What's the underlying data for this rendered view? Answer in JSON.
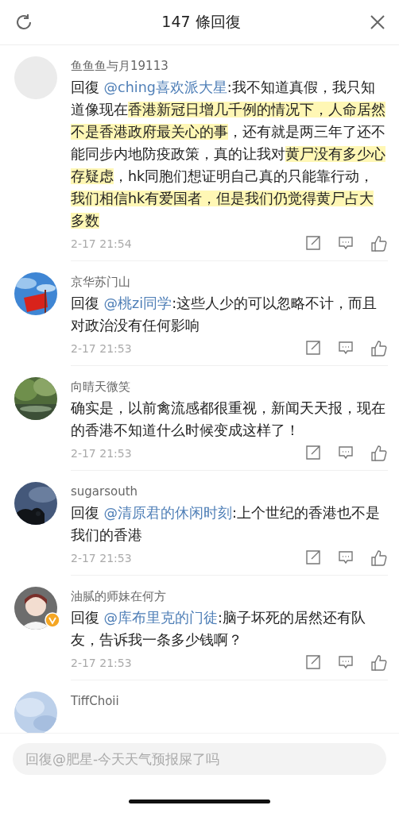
{
  "header": {
    "title": "147 條回復"
  },
  "comments": [
    {
      "username": "鱼鱼鱼与月19113",
      "verified": false,
      "reply_label": "回復",
      "mention": "@ching喜欢派大星",
      "body": [
        {
          "text": ":我不知道真假，我只知道像现在",
          "highlighted": false
        },
        {
          "text": "香港新冠日增几千例的情况下，人命居然不是香港政府最关心的事",
          "highlighted": true
        },
        {
          "text": "，还有就是两三年了还不能同步内地防疫政策，真的让我对",
          "highlighted": false
        },
        {
          "text": "黄尸没有多少心存疑虑",
          "highlighted": true
        },
        {
          "text": "，hk同胞们想证明自己真的只能靠行动，",
          "highlighted": false
        },
        {
          "text": "我们相信hk有爱国者，但是我们仍觉得黄尸占大多数",
          "highlighted": true
        }
      ],
      "time": "2-17 21:54"
    },
    {
      "username": "京华苏门山",
      "verified": false,
      "reply_label": "回復",
      "mention": "@桃zi同学",
      "body": [
        {
          "text": ":这些人少的可以忽略不计，而且对政治没有任何影响",
          "highlighted": false
        }
      ],
      "time": "2-17 21:53"
    },
    {
      "username": "向晴天微笑",
      "verified": false,
      "body": [
        {
          "text": "确实是，以前禽流感都很重视，新闻天天报，现在的香港不知道什么时候变成这样了！",
          "highlighted": false
        }
      ],
      "time": "2-17 21:53"
    },
    {
      "username": "sugarsouth",
      "verified": false,
      "reply_label": "回復",
      "mention": "@清原君的休闲时刻",
      "body": [
        {
          "text": ":上个世纪的香港也不是我们的香港",
          "highlighted": false
        }
      ],
      "time": "2-17 21:53"
    },
    {
      "username": "油腻的师妹在何方",
      "verified": true,
      "reply_label": "回復",
      "mention": "@库布里克的门徒",
      "body": [
        {
          "text": ":脑子坏死的居然还有队友，告诉我一条多少钱啊？",
          "highlighted": false
        }
      ],
      "time": "2-17 21:53"
    },
    {
      "username": "TiffChoii"
    }
  ],
  "reply_field": {
    "placeholder": "回復@肥星-今天天气预报屎了吗"
  }
}
